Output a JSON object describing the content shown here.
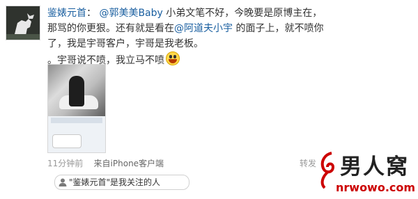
{
  "post": {
    "author": "鉴婊元首",
    "colon": "：",
    "mention1": "@郭美美Baby",
    "text1": " 小弟文笔不好，今晚要是原博主在，那骂的你更狠。还有就是看在",
    "mention2": "@阿道夫小宇",
    "text2": " 的面子上，就不喷你了，我是宇哥客户，宇哥是我老板。",
    "text3": "。宇哥说不喷，我立马不喷"
  },
  "meta": {
    "time": "11分钟前",
    "source": "来自iPhone客户端",
    "forward": "转发"
  },
  "follow_note": "\"鉴婊元首\"是我关注的人",
  "watermark": {
    "logo_text": "男人窝",
    "url": "nrwowo.com"
  },
  "colors": {
    "link": "#1a5fa0",
    "watermark_red": "#cc0000"
  }
}
